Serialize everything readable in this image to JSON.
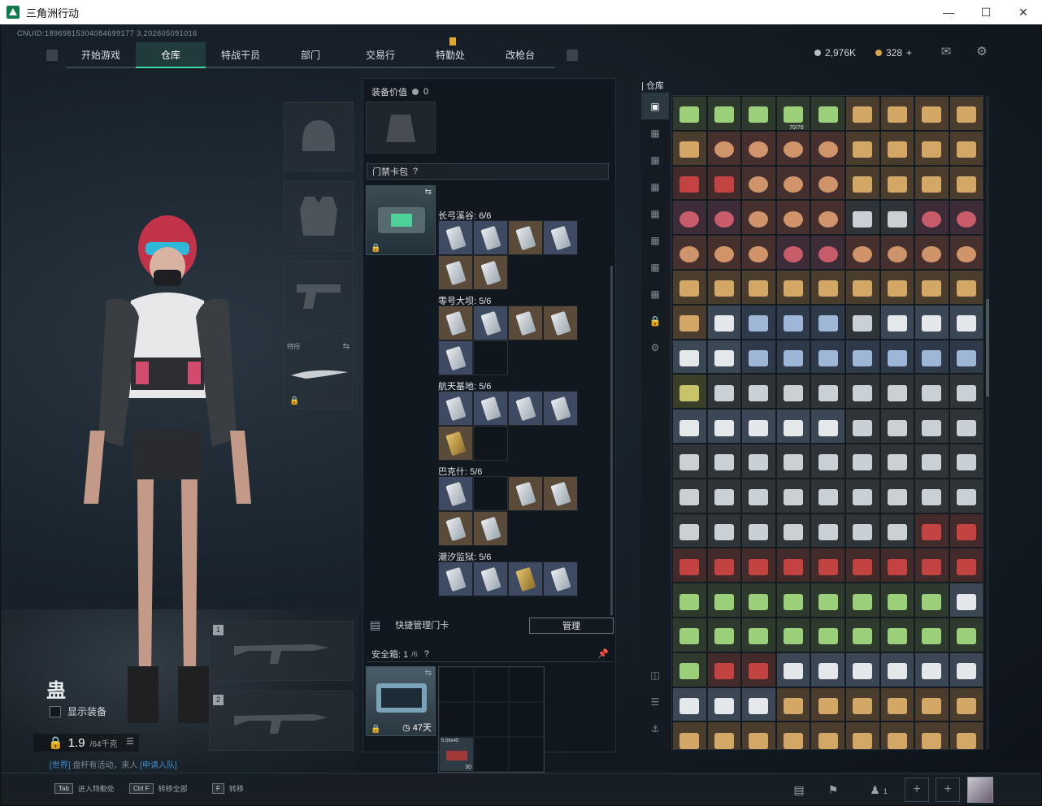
{
  "window": {
    "title": "三角洲行动"
  },
  "cnuid": "CNUID:18969815304084699177 3,202605091016",
  "nav": {
    "tabs": [
      "开始游戏",
      "仓库",
      "特战干员",
      "部门",
      "交易行",
      "特勤处",
      "改枪台"
    ],
    "active": "仓库"
  },
  "currency": {
    "coins": "2,976K",
    "tickets": "328",
    "plus": "+"
  },
  "player": {
    "name": "蛊",
    "show_gear": "显示装备",
    "weight": "1.9",
    "weight_max": "/64千克"
  },
  "recruit": {
    "prefix": "[世界]",
    "text": "盘杆有活动，来人",
    "link": "[申请入队]"
  },
  "equipment": {
    "melee_tag": "特拐",
    "slot1": "1",
    "slot2": "2"
  },
  "middle": {
    "gear_value_label": "装备价值",
    "gear_value": "0",
    "keycard_title": "门禁卡包",
    "maps": [
      {
        "label": "长弓溪谷: 6/6"
      },
      {
        "label": "零号大坝: 5/6"
      },
      {
        "label": "航天基地: 5/6"
      },
      {
        "label": "巴克什: 5/6"
      },
      {
        "label": "潮汐监狱: 5/6"
      }
    ],
    "quick_manage": "快捷管理门卡",
    "manage_btn": "管理",
    "safe_label": "安全箱: 1",
    "safe_cap": "/6",
    "safe_timer": "47天",
    "safe_item_name": "5.56x45",
    "safe_item_count": "30"
  },
  "warehouse": {
    "label": "仓库",
    "capacity": "70/70"
  },
  "bottom": {
    "hint1_key": "Tab",
    "hint1": "进入特勤处",
    "hint2_key": "Ctrl F",
    "hint2": "转移全部",
    "hint3_key": "F",
    "hint3": "转移",
    "team_count": "1"
  }
}
